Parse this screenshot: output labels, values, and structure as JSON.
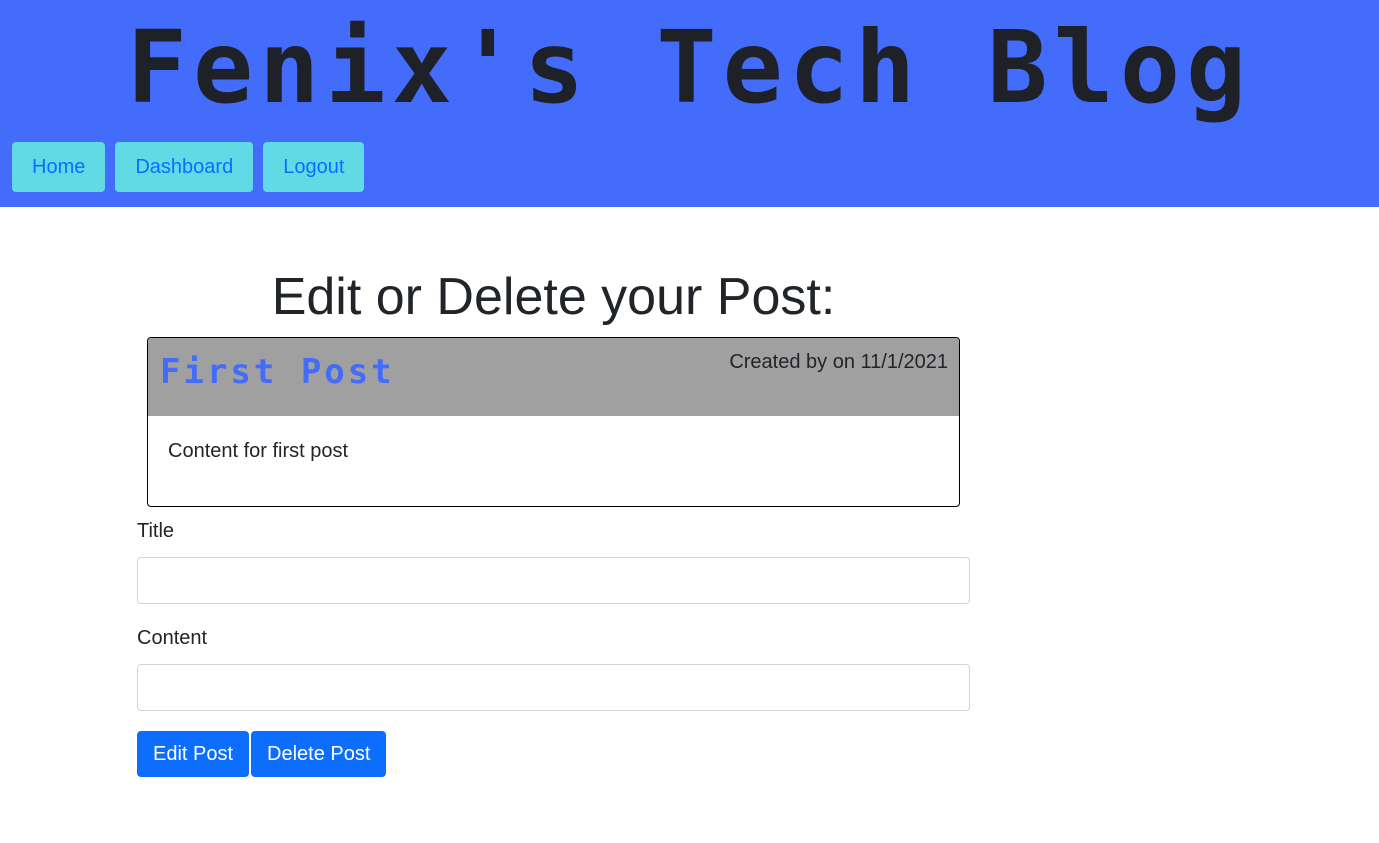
{
  "site": {
    "title": "Fenix's Tech Blog"
  },
  "nav": {
    "items": [
      {
        "label": "Home"
      },
      {
        "label": "Dashboard"
      },
      {
        "label": "Logout"
      }
    ]
  },
  "main": {
    "heading": "Edit or Delete your Post:",
    "post": {
      "title": "First Post",
      "meta": "Created by on 11/1/2021",
      "content": "Content for first post"
    },
    "form": {
      "title_label": "Title",
      "title_value": "",
      "content_label": "Content",
      "content_value": "",
      "edit_label": "Edit Post",
      "delete_label": "Delete Post"
    }
  },
  "colors": {
    "header_bg": "#436cfb",
    "nav_button_bg": "#61dae6",
    "link_blue": "#0d6efd",
    "card_header_bg": "#a0a0a0"
  }
}
